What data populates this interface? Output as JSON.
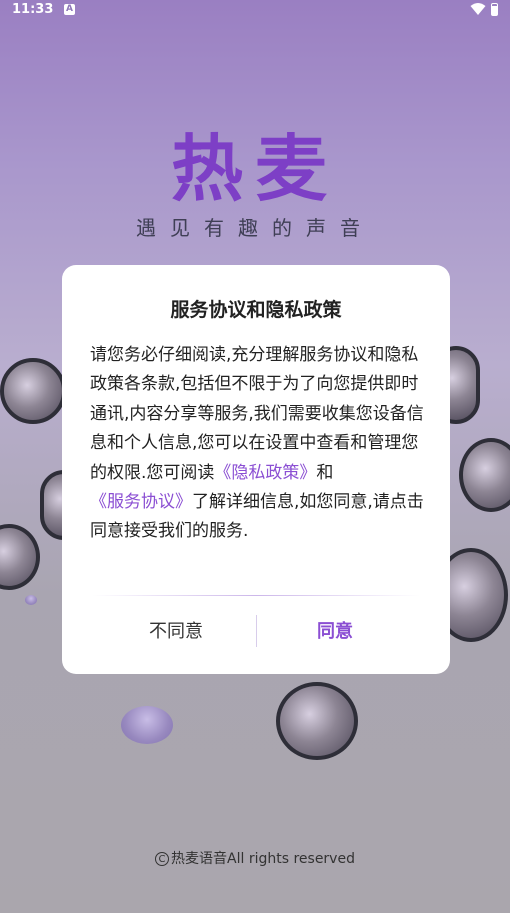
{
  "status_bar": {
    "time": "11:33",
    "notification_badge": "A"
  },
  "app": {
    "logo": "热麦",
    "slogan": "遇见有趣的声音"
  },
  "dialog": {
    "title": "服务协议和隐私政策",
    "body_part1": "请您务必仔细阅读,充分理解服务协议和隐私政策各条款,包括但不限于为了向您提供即时通讯,内容分享等服务,我们需要收集您设备信息和个人信息,您可以在设置中查看和管理您的权限.您可阅读",
    "privacy_link": "《隐私政策》",
    "body_and": "和",
    "service_link": "《服务协议》",
    "body_part2": "了解详细信息,如您同意,请点击同意接受我们的服务.",
    "disagree_label": "不同意",
    "agree_label": "同意"
  },
  "footer": {
    "copyright_symbol": "C",
    "copyright_text": "热麦语音All rights reserved"
  },
  "colors": {
    "accent": "#8b4fd3",
    "logo": "#7d3fc6"
  }
}
